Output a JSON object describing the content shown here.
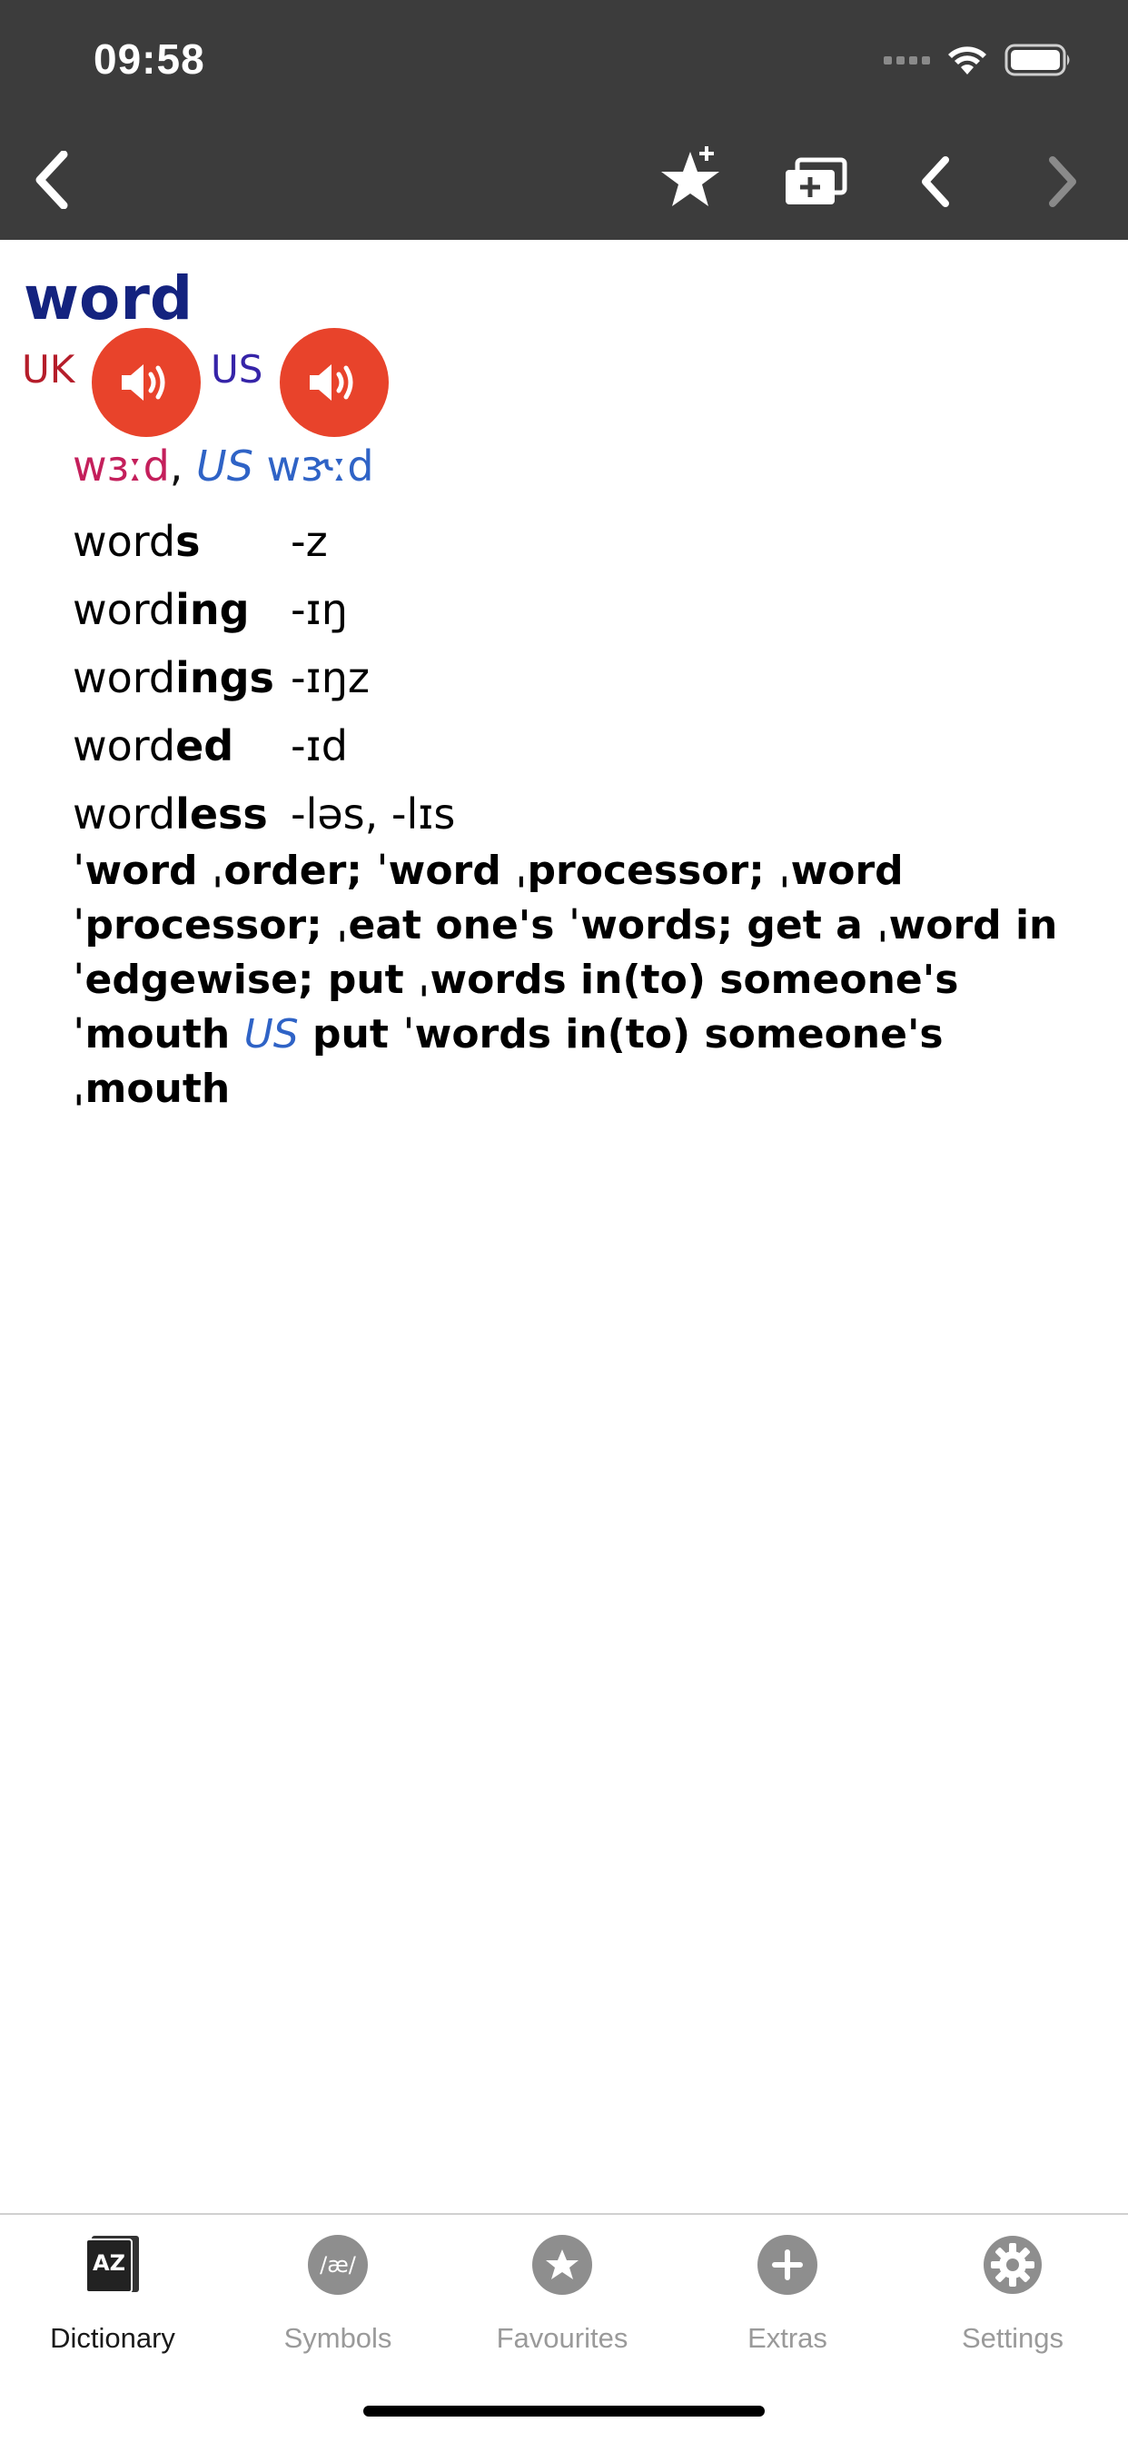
{
  "status_bar": {
    "time": "09:58"
  },
  "entry": {
    "headword": "word",
    "uk_label": "UK",
    "us_label": "US",
    "pronunciation": {
      "uk_ipa": "wɜːd",
      "separator": ",",
      "us_tag": "US",
      "us_ipa": "wɝːd"
    },
    "forms": [
      {
        "stem": "word",
        "suffix": "s",
        "ending": "-z"
      },
      {
        "stem": "word",
        "suffix": "ing",
        "ending": "-ɪŋ"
      },
      {
        "stem": "word",
        "suffix": "ings",
        "ending": "-ɪŋz"
      },
      {
        "stem": "word",
        "suffix": "ed",
        "ending": "-ɪd"
      },
      {
        "stem": "word",
        "suffix": "less",
        "ending": "-ləs, -lɪs"
      }
    ],
    "phrases_part1": "ˈword ˌorder; ˈword ˌprocessor; ˌword ˈprocessor; ˌeat one's ˈwords; get a ˌword in ˈedgewise; put ˌwords in(to) someone's ˈmouth",
    "phrases_us_label": "US",
    "phrases_part2": "put ˈwords in(to) someone's ˌmouth"
  },
  "tabs": [
    {
      "label": "Dictionary",
      "icon": "dictionary-az-icon",
      "active": true
    },
    {
      "label": "Symbols",
      "icon": "symbols-ipa-icon",
      "glyph": "/æ/",
      "active": false
    },
    {
      "label": "Favourites",
      "icon": "star-icon",
      "active": false
    },
    {
      "label": "Extras",
      "icon": "plus-icon",
      "active": false
    },
    {
      "label": "Settings",
      "icon": "gear-icon",
      "active": false
    }
  ],
  "colors": {
    "header_bg": "#3c3c3c",
    "headword": "#14237f",
    "uk": "#b51d2a",
    "us": "#3624a8",
    "speaker": "#e8432b",
    "us_ipa": "#2f63c6",
    "uk_ipa": "#c41f5b"
  }
}
